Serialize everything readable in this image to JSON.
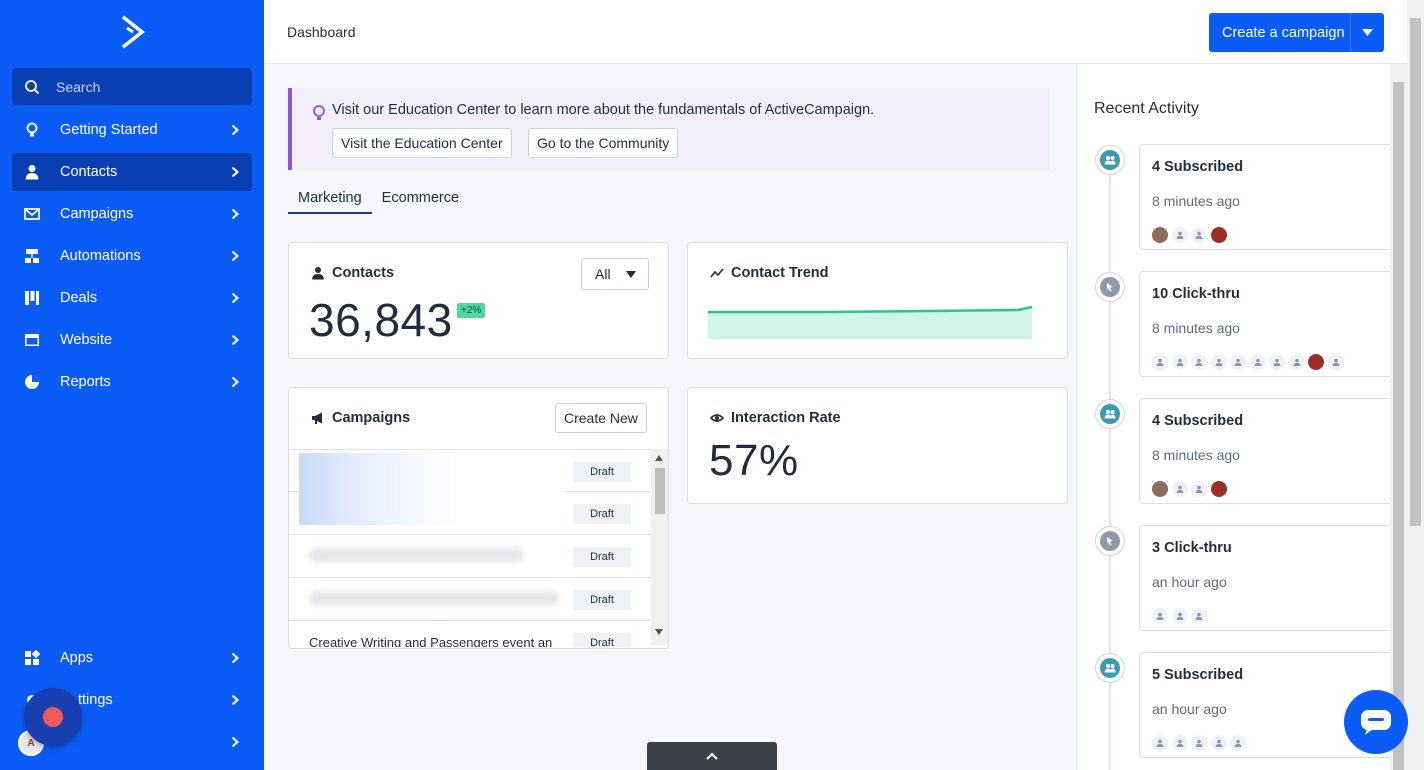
{
  "app": {
    "brand_color": "#0b5cf7"
  },
  "sidebar": {
    "search_placeholder": "Search",
    "items": [
      {
        "label": "Getting Started",
        "icon": "lightbulb-icon"
      },
      {
        "label": "Contacts",
        "icon": "person-icon",
        "active": true
      },
      {
        "label": "Campaigns",
        "icon": "envelope-icon"
      },
      {
        "label": "Automations",
        "icon": "automation-icon"
      },
      {
        "label": "Deals",
        "icon": "deals-icon"
      },
      {
        "label": "Website",
        "icon": "website-icon"
      },
      {
        "label": "Reports",
        "icon": "pie-chart-icon"
      }
    ],
    "bottom_items": [
      {
        "label": "Apps",
        "icon": "apps-icon"
      },
      {
        "label": "Settings",
        "visible_label": "ttings",
        "icon": "gear-icon"
      }
    ]
  },
  "header": {
    "title": "Dashboard",
    "cta_label": "Create a campaign"
  },
  "banner": {
    "text": "Visit our Education Center to learn more about the fundamentals of ActiveCampaign.",
    "primary_button": "Visit the Education Center",
    "secondary_button": "Go to the Community"
  },
  "tabs": [
    {
      "label": "Marketing",
      "active": true
    },
    {
      "label": "Ecommerce",
      "active": false
    }
  ],
  "contacts_card": {
    "title": "Contacts",
    "filter": "All",
    "count": "36,843",
    "change": "+2%"
  },
  "trend_card": {
    "title": "Contact Trend"
  },
  "campaigns_card": {
    "title": "Campaigns",
    "create_button": "Create New",
    "rows": [
      {
        "name": "",
        "status": "Draft"
      },
      {
        "name": "",
        "status": "Draft"
      },
      {
        "name": "",
        "status": "Draft"
      },
      {
        "name": "",
        "status": "Draft"
      },
      {
        "name": "Creative Writing and Passengers event an",
        "status": "Draft"
      }
    ]
  },
  "interaction_card": {
    "title": "Interaction Rate",
    "value": "57%"
  },
  "activity": {
    "title": "Recent Activity",
    "items": [
      {
        "heading": "4 Subscribed",
        "time": "8 minutes ago",
        "type": "subscribed",
        "avatars": [
          "photo1",
          "blank",
          "blank",
          "photo2"
        ]
      },
      {
        "heading": "10 Click-thru",
        "time": "8 minutes ago",
        "type": "click",
        "avatars": [
          "blank",
          "blank",
          "blank",
          "blank",
          "blank",
          "blank",
          "blank",
          "blank",
          "photo2",
          "blank"
        ]
      },
      {
        "heading": "4 Subscribed",
        "time": "8 minutes ago",
        "type": "subscribed",
        "avatars": [
          "photo1",
          "blank",
          "blank",
          "photo2"
        ]
      },
      {
        "heading": "3 Click-thru",
        "time": "an hour ago",
        "type": "click",
        "avatars": [
          "blank",
          "blank",
          "blank"
        ]
      },
      {
        "heading": "5 Subscribed",
        "time": "an hour ago",
        "type": "subscribed",
        "avatars": [
          "blank",
          "blank",
          "blank",
          "blank",
          "blank"
        ]
      }
    ]
  }
}
